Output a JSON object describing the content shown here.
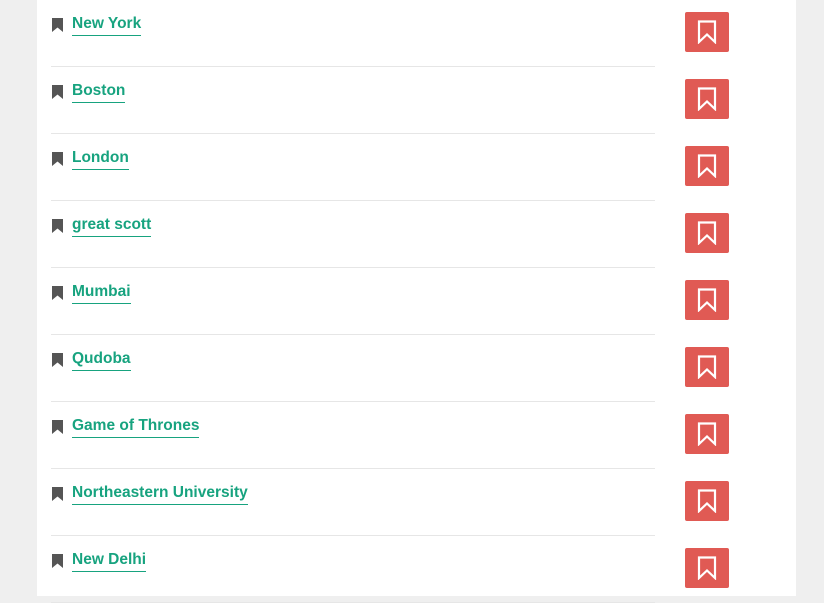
{
  "bookmarks": [
    {
      "label": "New York"
    },
    {
      "label": "Boston"
    },
    {
      "label": "London"
    },
    {
      "label": "great scott"
    },
    {
      "label": "Mumbai"
    },
    {
      "label": "Qudoba"
    },
    {
      "label": "Game of Thrones"
    },
    {
      "label": "Northeastern University"
    },
    {
      "label": "New Delhi"
    }
  ],
  "icons": {
    "row_icon": "bookmark-icon",
    "button_icon": "bookmark-outline-icon"
  },
  "colors": {
    "link": "#17a37f",
    "button": "#e05a54",
    "icon": "#555555"
  }
}
